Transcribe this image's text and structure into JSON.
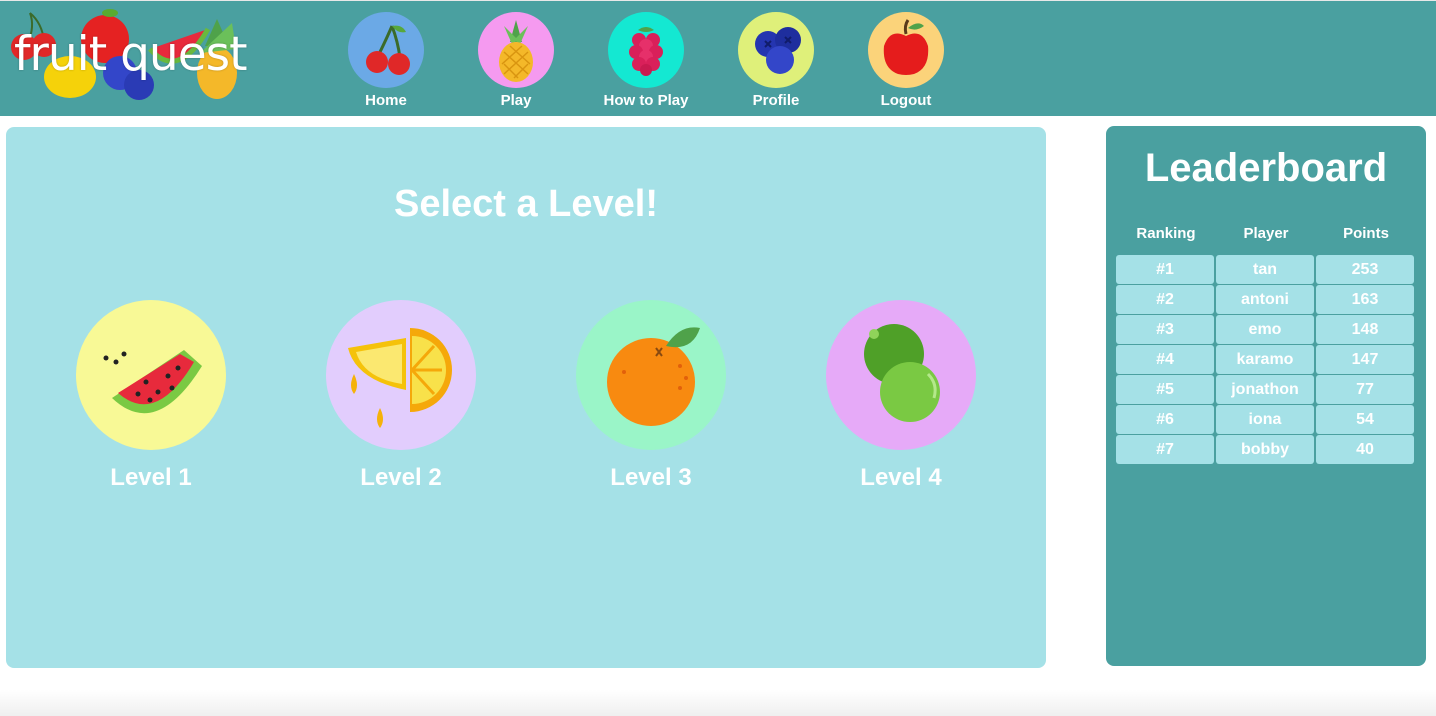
{
  "app": {
    "logo_text": "fruit quest",
    "colors": {
      "topbar": "#4aa0a0",
      "main_panel": "#a5e1e7",
      "leaderboard_panel": "#4aa0a0",
      "text": "#ffffff"
    }
  },
  "nav": {
    "items": [
      {
        "label": "Home",
        "icon": "cherry-icon",
        "bg": "#6ba9e6"
      },
      {
        "label": "Play",
        "icon": "pineapple-icon",
        "bg": "#f59af0"
      },
      {
        "label": "How to Play",
        "icon": "raspberry-icon",
        "bg": "#14e8d2"
      },
      {
        "label": "Profile",
        "icon": "blueberry-icon",
        "bg": "#dff07a"
      },
      {
        "label": "Logout",
        "icon": "apple-icon",
        "bg": "#fbd37a"
      }
    ]
  },
  "main": {
    "title": "Select a Level!",
    "levels": [
      {
        "label": "Level 1",
        "icon": "watermelon-icon",
        "bg": "#f8f996"
      },
      {
        "label": "Level 2",
        "icon": "lemon-icon",
        "bg": "#e2cdfd"
      },
      {
        "label": "Level 3",
        "icon": "orange-icon",
        "bg": "#9af5c8"
      },
      {
        "label": "Level 4",
        "icon": "lime-icon",
        "bg": "#e6aaf8"
      }
    ]
  },
  "leaderboard": {
    "title": "Leaderboard",
    "headers": [
      "Ranking",
      "Player",
      "Points"
    ],
    "rows": [
      {
        "rank": "#1",
        "player": "tan",
        "points": "253"
      },
      {
        "rank": "#2",
        "player": "antoni",
        "points": "163"
      },
      {
        "rank": "#3",
        "player": "emo",
        "points": "148"
      },
      {
        "rank": "#4",
        "player": "karamo",
        "points": "147"
      },
      {
        "rank": "#5",
        "player": "jonathon",
        "points": "77"
      },
      {
        "rank": "#6",
        "player": "iona",
        "points": "54"
      },
      {
        "rank": "#7",
        "player": "bobby",
        "points": "40"
      }
    ]
  }
}
